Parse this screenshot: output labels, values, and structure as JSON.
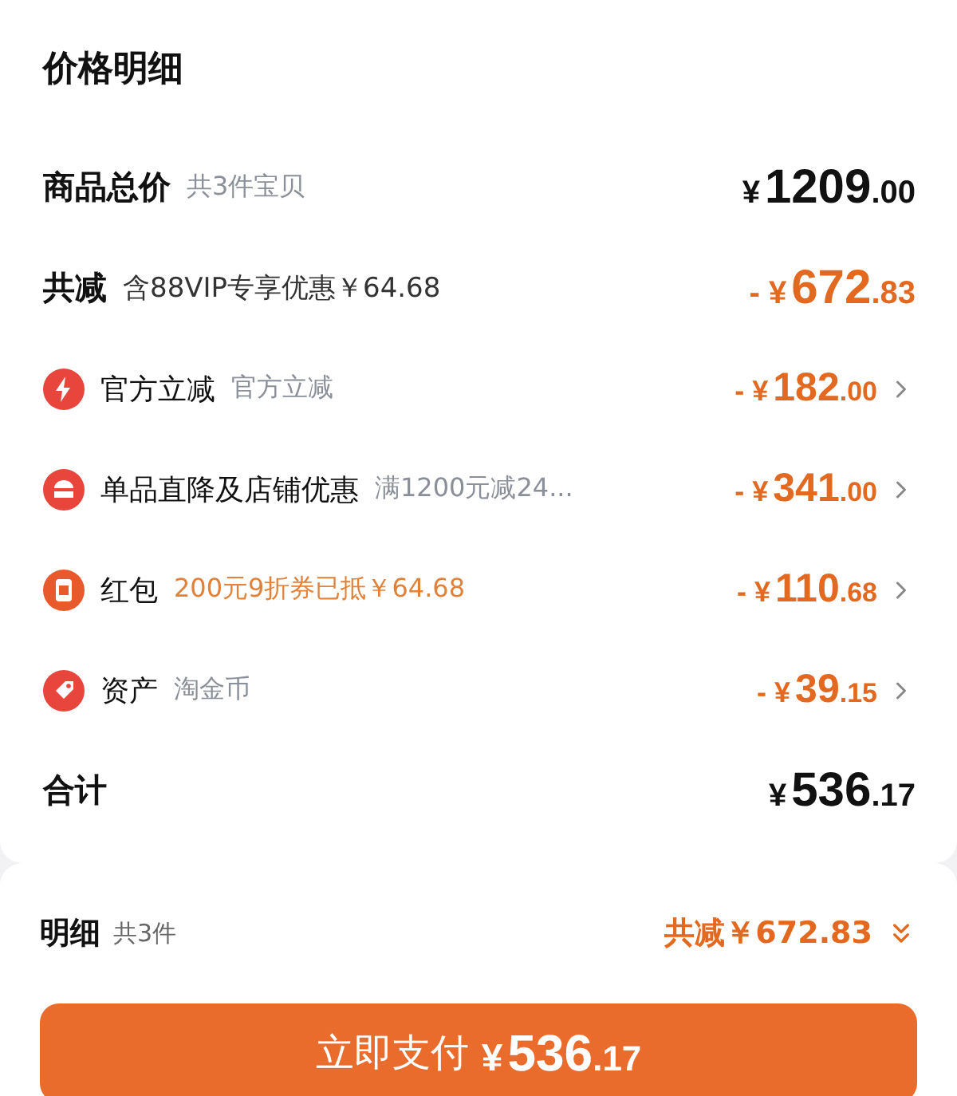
{
  "card": {
    "title": "价格明细",
    "subtotal": {
      "label": "商品总价",
      "note": "共3件宝贝",
      "currency": "¥",
      "int": "1209",
      "dec": ".00"
    },
    "discount": {
      "label": "共减",
      "note": "含88VIP专享优惠￥64.68",
      "prefix": "- ¥",
      "int": "672",
      "dec": ".83"
    },
    "items": [
      {
        "kind": "lightning",
        "label": "官方立减",
        "note": "官方立减",
        "highlight": false,
        "prefix": "- ¥",
        "int": "182",
        "dec": ".00"
      },
      {
        "kind": "store",
        "label": "单品直降及店铺优惠",
        "note": "满1200元减24...",
        "highlight": false,
        "prefix": "- ¥",
        "int": "341",
        "dec": ".00"
      },
      {
        "kind": "packet",
        "label": "红包",
        "note": "200元9折券已抵￥64.68",
        "highlight": true,
        "prefix": "- ¥",
        "int": "110",
        "dec": ".68"
      },
      {
        "kind": "tag",
        "label": "资产",
        "note": "淘金币",
        "highlight": false,
        "prefix": "- ¥",
        "int": "39",
        "dec": ".15"
      }
    ],
    "total": {
      "label": "合计",
      "currency": "¥",
      "int": "536",
      "dec": ".17"
    }
  },
  "footer": {
    "label": "明细",
    "count": "共3件",
    "saving": "共减￥672.83",
    "pay": {
      "label": "立即支付",
      "currency": "¥",
      "int": "536",
      "dec": ".17"
    }
  }
}
